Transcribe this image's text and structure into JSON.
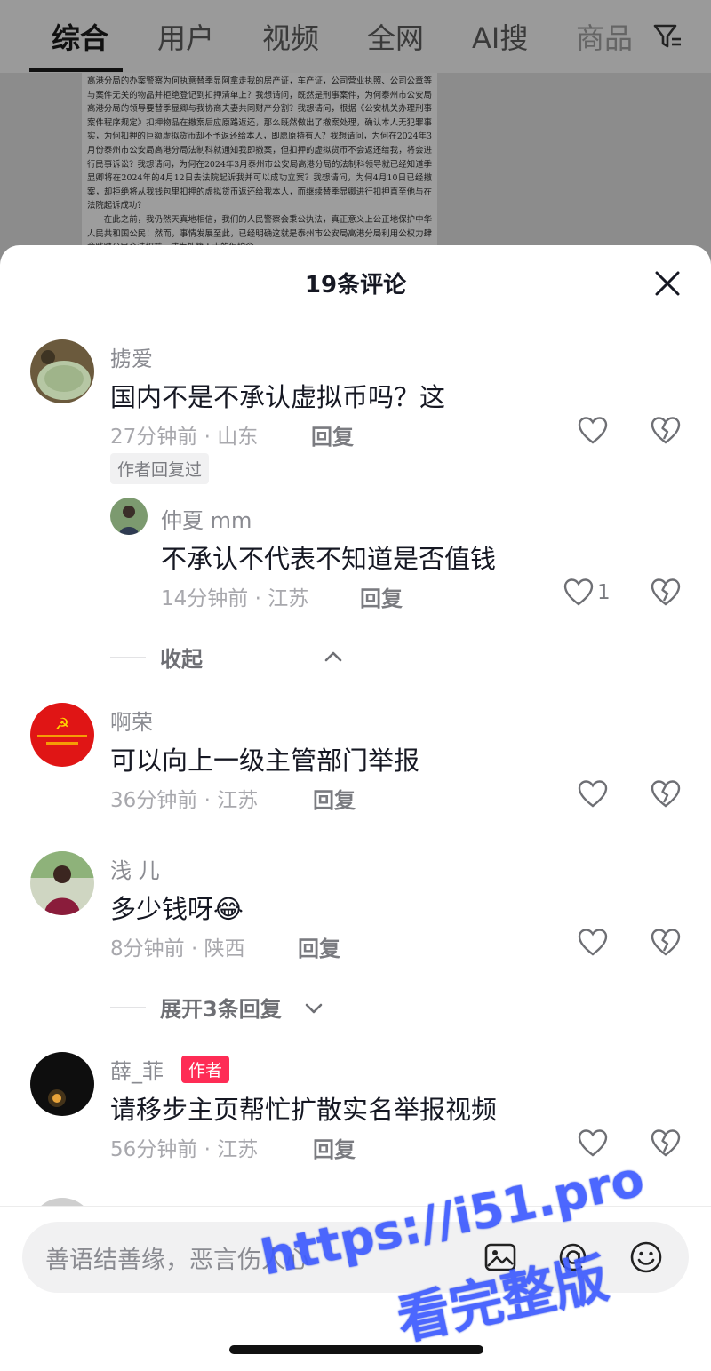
{
  "search_tabs": [
    {
      "label": "综合",
      "active": true
    },
    {
      "label": "用户",
      "active": false
    },
    {
      "label": "视频",
      "active": false
    },
    {
      "label": "全网",
      "active": false
    },
    {
      "label": "AI搜",
      "active": false
    },
    {
      "label": "商品",
      "active": false
    }
  ],
  "filter_icon": "filter-icon",
  "background_document": {
    "paragraphs": [
      "高港分局的办案警察为何执意替季显阿拿走我的房产证，车产证，公司营业执照、公司公章等与案件无关的物品并拒绝登记到扣押清单上？我想请问，既然是刑事案件，为何泰州市公安局高港分局的领导要替季显卿与我协商夫妻共同财产分割？我想请问，根据《公安机关办理刑事案件程序规定》扣押物品在撤案后应原路返还，那么既然做出了撤案处理，确认本人无犯罪事实，为何扣押的巨额虚拟货币却不予返还给本人，即愿原持有人？我想请问，为何在2024年3月份泰州市公安局高港分局法制科就通知我即撤案，但扣押的虚拟货币不会返还给我，将会进行民事诉讼？我想请问，为何在2024年3月泰州市公安局高港分局的法制科领导就已经知道季显卿将在2024年的4月12日去法院起诉我并可以成功立案？我想请问，为何4月10日已经撤案，却拒绝将从我钱包里扣押的虚拟货币返还给我本人，而继续替季显卿进行扣押直至他与在法院起诉成功？",
      "在此之前，我仍然天真地相信，我们的人民警察会秉公执法，真正意义上公正地保护中华人民共和国公民！然而，事情发展至此，已经明确这就是泰州市公安局高港分局利用公权力肆意践踏公民合法权益，成为外籍人士的保护伞。"
    ]
  },
  "comments_sheet": {
    "title": "19条评论",
    "close_icon": "close-icon",
    "comments": [
      {
        "username": "掳爱",
        "text": "国内不是不承认虚拟币吗？这",
        "meta": "27分钟前 · 山东",
        "reply_label": "回复",
        "author_replied_tag": "作者回复过",
        "replies": [
          {
            "username": "仲夏 mm",
            "text": "不承认不代表不知道是否值钱",
            "meta": "14分钟前 · 江苏",
            "reply_label": "回复",
            "like_count": "1"
          }
        ],
        "collapse_label": "收起"
      },
      {
        "username": "啊荣",
        "text": "可以向上一级主管部门举报",
        "meta": "36分钟前 · 江苏",
        "reply_label": "回复"
      },
      {
        "username": "浅 儿",
        "text": "多少钱呀",
        "emoji": "😂",
        "meta": "8分钟前 · 陕西",
        "reply_label": "回复",
        "expand_label": "展开3条回复"
      },
      {
        "username": "薛_菲",
        "author_badge": "作者",
        "text": "请移步主页帮忙扩散实名举报视频",
        "meta": "56分钟前 · 江苏",
        "reply_label": "回复"
      }
    ]
  },
  "input_bar": {
    "placeholder": "善语结善缘，恶言伤人心",
    "icons": [
      "image-icon",
      "at-mention-icon",
      "emoji-icon"
    ]
  },
  "watermark": {
    "line1": "https://i51.pro",
    "line2": "看完整版"
  },
  "colors": {
    "accent_red": "#fe2c55",
    "text_primary": "#161823",
    "text_secondary": "#8a8b91",
    "watermark_blue": "#3d5bff"
  }
}
